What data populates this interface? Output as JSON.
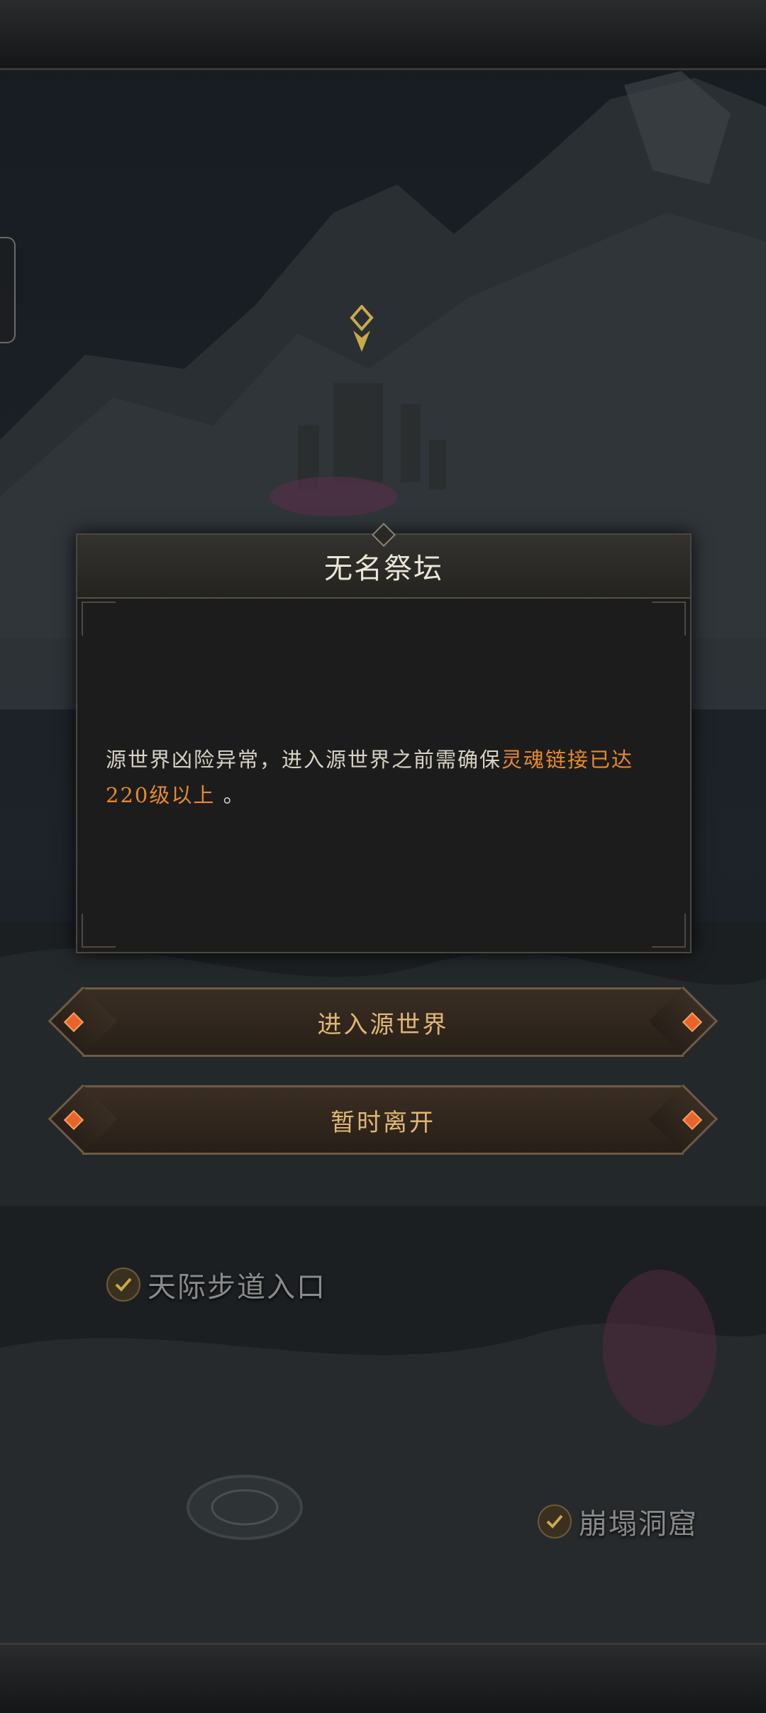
{
  "dialog": {
    "title": "无名祭坛",
    "message_normal": "源世界凶险异常，进入源世界之前需确保",
    "message_highlight": "灵魂链接已达220级以上",
    "message_end": "。"
  },
  "buttons": {
    "enter_label": "进入源世界",
    "leave_label": "暂时离开"
  },
  "map_locations": [
    {
      "label": "天际步道入口",
      "icon": "check-icon"
    },
    {
      "label": "崩塌洞窟",
      "icon": "check-icon"
    }
  ],
  "colors": {
    "accent_orange": "#e8892e",
    "button_text": "#e1b673",
    "title_text": "#ece6d8"
  }
}
